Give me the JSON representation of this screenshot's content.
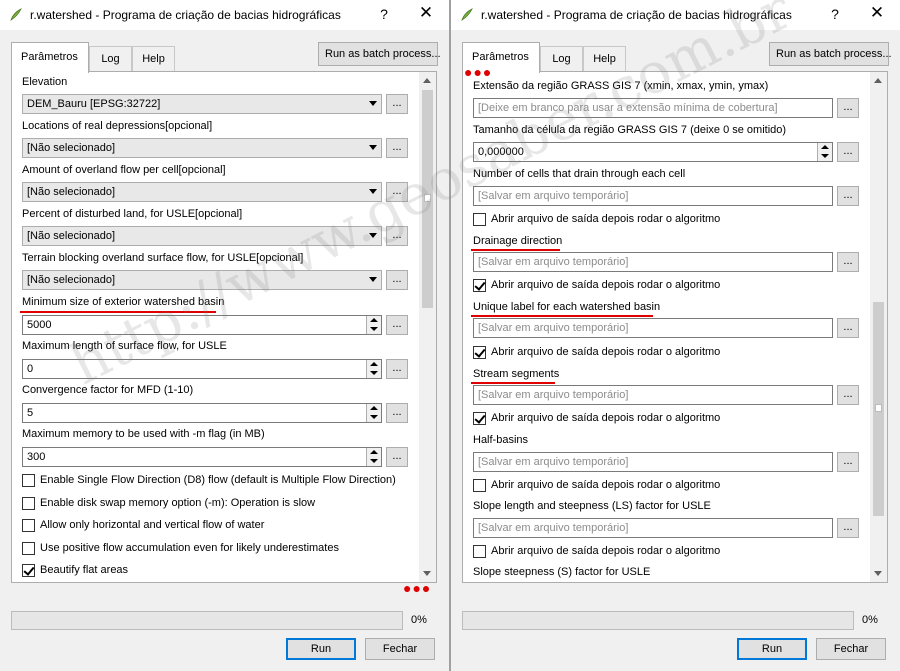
{
  "left": {
    "title": "r.watershed - Programa de criação de bacias hidrográficas",
    "help": "?",
    "close": "✕",
    "tabs": [
      "Parâmetros",
      "Log",
      "Help"
    ],
    "batch": "Run as batch process...",
    "params": {
      "elevation_label": "Elevation",
      "elevation_value": "DEM_Bauru [EPSG:32722]",
      "depressions_label": "Locations of real depressions[opcional]",
      "depressions_value": "[Não selecionado]",
      "overland_label": "Amount of overland flow per cell[opcional]",
      "overland_value": "[Não selecionado]",
      "disturbed_label": "Percent of disturbed land, for USLE[opcional]",
      "disturbed_value": "[Não selecionado]",
      "blocking_label": "Terrain blocking overland surface flow, for USLE[opcional]",
      "blocking_value": "[Não selecionado]",
      "minsize_label": "Minimum size of exterior watershed basin",
      "minsize_value": "5000",
      "maxlen_label": "Maximum length of surface flow, for USLE",
      "maxlen_value": "0",
      "convergence_label": "Convergence factor for MFD (1-10)",
      "convergence_value": "5",
      "memory_label": "Maximum memory to be used with -m flag (in MB)",
      "memory_value": "300",
      "dots": "..."
    },
    "checks": [
      {
        "label": "Enable Single Flow Direction (D8) flow (default is Multiple Flow Direction)",
        "checked": false
      },
      {
        "label": "Enable disk swap memory option (-m): Operation is slow",
        "checked": false
      },
      {
        "label": "Allow only horizontal and vertical flow of water",
        "checked": false
      },
      {
        "label": "Use positive flow accumulation even for likely underestimates",
        "checked": false
      },
      {
        "label": "Beautify flat areas",
        "checked": true
      }
    ],
    "progress_pct": "0%",
    "run": "Run",
    "close_btn": "Fechar",
    "reddots": "●●●"
  },
  "right": {
    "title": "r.watershed - Programa de criação de bacias hidrográficas",
    "help": "?",
    "close": "✕",
    "tabs": [
      "Parâmetros",
      "Log",
      "Help"
    ],
    "batch": "Run as batch process...",
    "extent_label": "Extensão da região GRASS GIS 7 (xmin, xmax, ymin, ymax)",
    "extent_placeholder": "[Deixe em branco para usar a extensão mínima de cobertura]",
    "cellsize_label": "Tamanho da célula da região GRASS GIS 7 (deixe 0 se omitido)",
    "cellsize_value": "0,000000",
    "outputs": [
      {
        "label": "Number of cells that drain through each cell",
        "placeholder": "[Salvar em arquivo temporário]",
        "open_label": "Abrir arquivo de saída depois rodar o algoritmo",
        "open_checked": false
      },
      {
        "label": "Drainage direction",
        "placeholder": "[Salvar em arquivo temporário]",
        "open_label": "Abrir arquivo de saída depois rodar o algoritmo",
        "open_checked": true
      },
      {
        "label": "Unique label for each watershed basin",
        "placeholder": "[Salvar em arquivo temporário]",
        "open_label": "Abrir arquivo de saída depois rodar o algoritmo",
        "open_checked": true
      },
      {
        "label": "Stream segments",
        "placeholder": "[Salvar em arquivo temporário]",
        "open_label": "Abrir arquivo de saída depois rodar o algoritmo",
        "open_checked": true
      },
      {
        "label": "Half-basins",
        "placeholder": "[Salvar em arquivo temporário]",
        "open_label": "Abrir arquivo de saída depois rodar o algoritmo",
        "open_checked": false
      },
      {
        "label": "Slope length and steepness (LS) factor for USLE",
        "placeholder": "[Salvar em arquivo temporário]",
        "open_label": "Abrir arquivo de saída depois rodar o algoritmo",
        "open_checked": false
      }
    ],
    "last_label": "Slope steepness (S) factor for USLE",
    "dots": "...",
    "progress_pct": "0%",
    "run": "Run",
    "close_btn": "Fechar",
    "reddots": "●●●"
  },
  "watermark": "http://www.geosaber.com.br",
  "colors": {
    "highlight": "#e00000",
    "accent": "#0078d7"
  }
}
